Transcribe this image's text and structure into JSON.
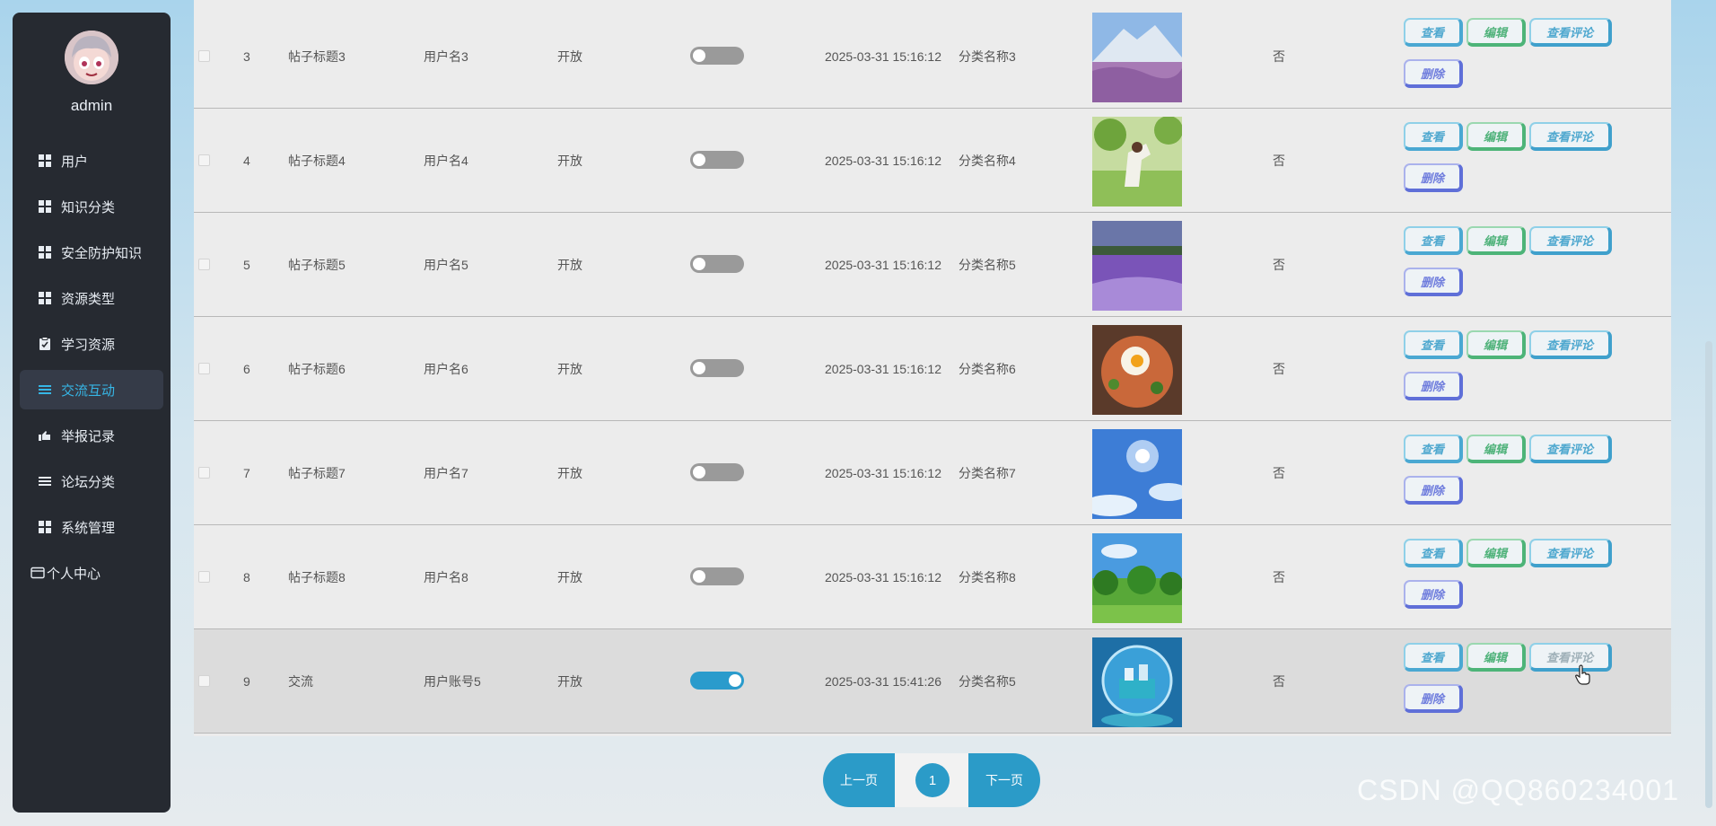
{
  "sidebar": {
    "username": "admin",
    "items": [
      {
        "label": "用户",
        "icon": "grid-icon"
      },
      {
        "label": "知识分类",
        "icon": "grid-icon"
      },
      {
        "label": "安全防护知识",
        "icon": "grid-icon"
      },
      {
        "label": "资源类型",
        "icon": "grid-icon"
      },
      {
        "label": "学习资源",
        "icon": "clipboard-icon"
      },
      {
        "label": "交流互动",
        "icon": "list-icon",
        "active": true
      },
      {
        "label": "举报记录",
        "icon": "hand-icon"
      },
      {
        "label": "论坛分类",
        "icon": "list-icon"
      },
      {
        "label": "系统管理",
        "icon": "grid-icon"
      },
      {
        "label": "个人中心",
        "icon": "card-icon"
      }
    ]
  },
  "table": {
    "rows": [
      {
        "id": "3",
        "title": "帖子标题3",
        "user": "用户名3",
        "status": "开放",
        "toggle": false,
        "time": "2025-03-31 15:16:12",
        "category": "分类名称3",
        "flag": "否",
        "image": "mountain-flowers-photo"
      },
      {
        "id": "4",
        "title": "帖子标题4",
        "user": "用户名4",
        "status": "开放",
        "toggle": false,
        "time": "2025-03-31 15:16:12",
        "category": "分类名称4",
        "flag": "否",
        "image": "girl-on-grass-photo"
      },
      {
        "id": "5",
        "title": "帖子标题5",
        "user": "用户名5",
        "status": "开放",
        "toggle": false,
        "time": "2025-03-31 15:16:12",
        "category": "分类名称5",
        "flag": "否",
        "image": "lavender-field-photo"
      },
      {
        "id": "6",
        "title": "帖子标题6",
        "user": "用户名6",
        "status": "开放",
        "toggle": false,
        "time": "2025-03-31 15:16:12",
        "category": "分类名称6",
        "flag": "否",
        "image": "pasta-egg-photo"
      },
      {
        "id": "7",
        "title": "帖子标题7",
        "user": "用户名7",
        "status": "开放",
        "toggle": false,
        "time": "2025-03-31 15:16:12",
        "category": "分类名称7",
        "flag": "否",
        "image": "blue-sky-sun-photo"
      },
      {
        "id": "8",
        "title": "帖子标题8",
        "user": "用户名8",
        "status": "开放",
        "toggle": false,
        "time": "2025-03-31 15:16:12",
        "category": "分类名称8",
        "flag": "否",
        "image": "meadow-trees-photo"
      },
      {
        "id": "9",
        "title": "交流",
        "user": "用户账号5",
        "status": "开放",
        "toggle": true,
        "time": "2025-03-31 15:41:26",
        "category": "分类名称5",
        "flag": "否",
        "image": "globe-city-photo"
      }
    ],
    "actions": {
      "view": "查看",
      "edit": "编辑",
      "comments": "查看评论",
      "delete": "删除"
    }
  },
  "pager": {
    "prev": "上一页",
    "page": "1",
    "next": "下一页"
  },
  "watermark": "CSDN @QQ860234001",
  "colors": {
    "sidebar_bg": "#262a31",
    "accent": "#2b9bc8",
    "active_text": "#36b6e6"
  }
}
